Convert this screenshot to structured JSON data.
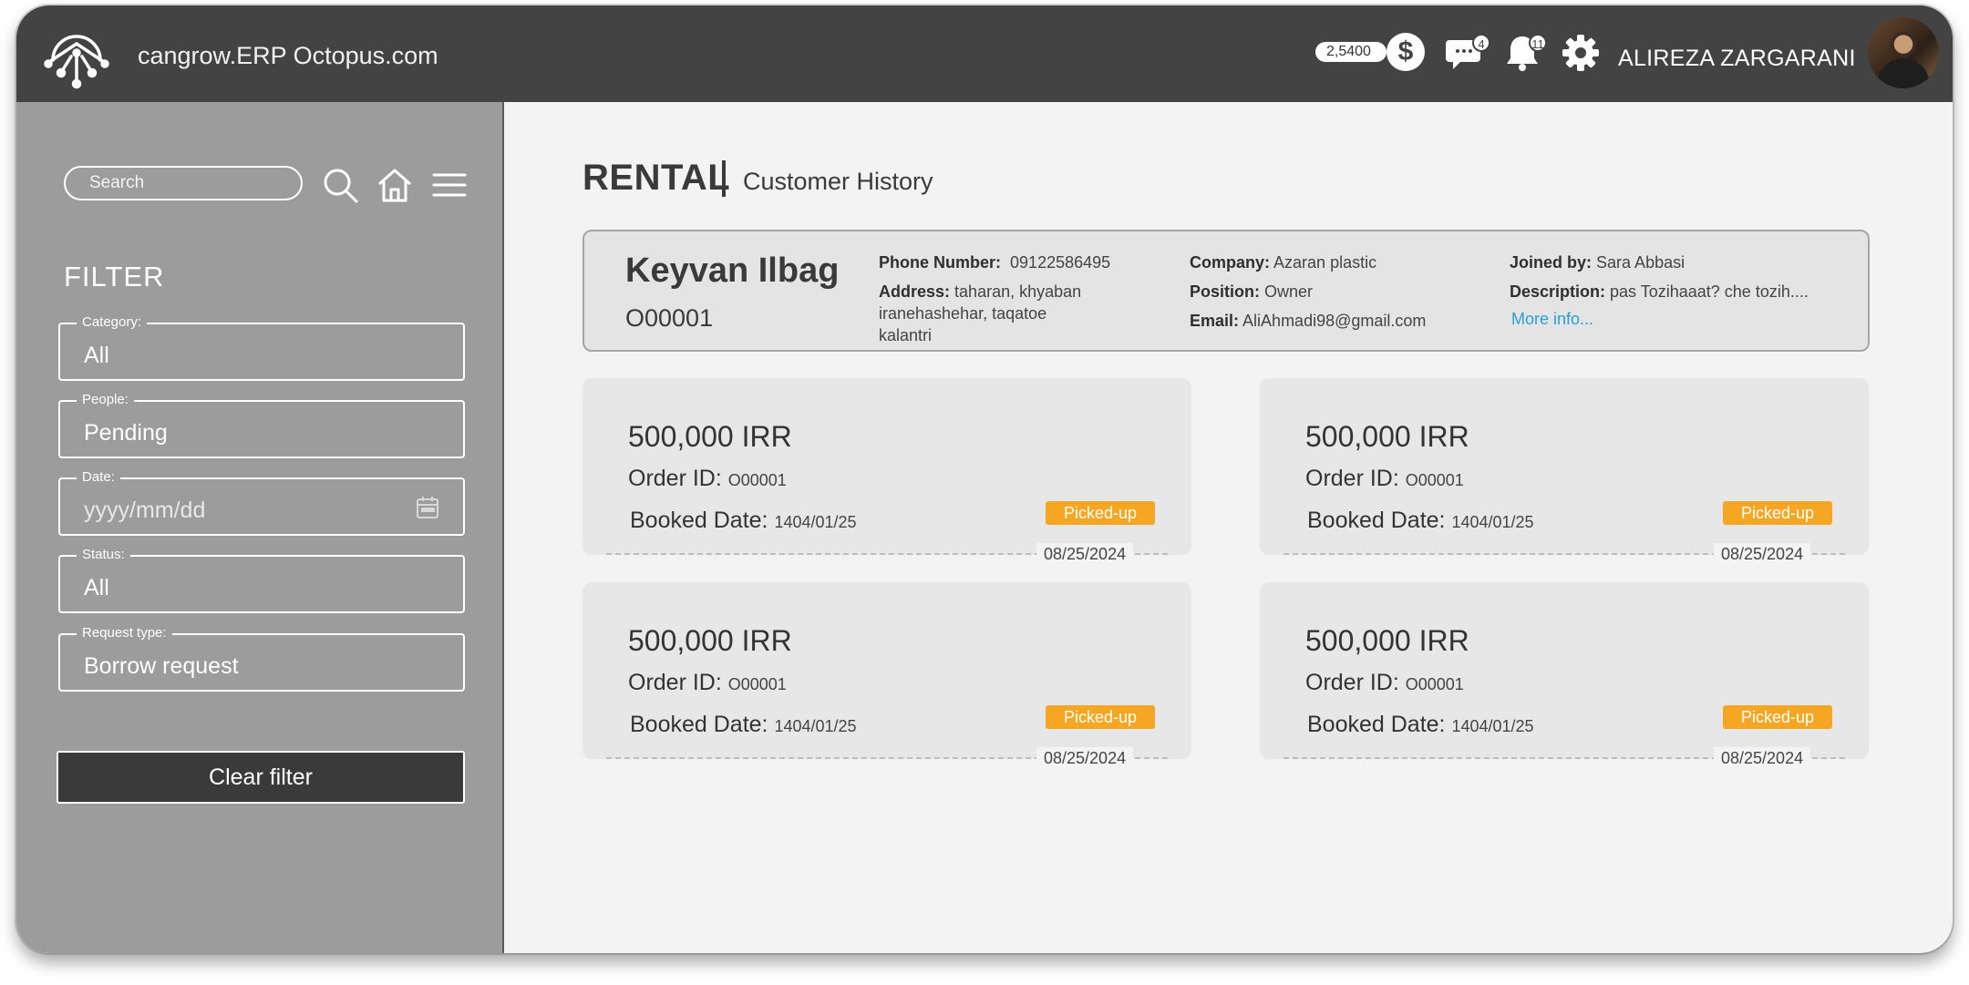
{
  "header": {
    "brand": "cangrow.ERP Octopus.com",
    "coin_balance": "2,5400",
    "coin_symbol": "$",
    "messages_count": "4",
    "notifications_count": "11",
    "user_name": "ALIREZA ZARGARANI",
    "icons": [
      "octopus-logo-icon",
      "dollar-coin-icon",
      "chat-bubble-icon",
      "bell-icon",
      "gear-icon"
    ]
  },
  "sidebar": {
    "search_placeholder": "Search",
    "filter_title": "FILTER",
    "fields": [
      {
        "label": "Category:",
        "value": "All"
      },
      {
        "label": "People:",
        "value": "Pending"
      },
      {
        "label": "Date:",
        "value": "yyyy/mm/dd"
      },
      {
        "label": "Status:",
        "value": "All"
      },
      {
        "label": "Request type:",
        "value": "Borrow request"
      }
    ],
    "clear_label": "Clear filter"
  },
  "page": {
    "title": "RENTAL",
    "subtitle": "Customer History"
  },
  "customer": {
    "name": "Keyvan Ilbag",
    "id": "O00001",
    "phone_label": "Phone Number:",
    "phone": "09122586495",
    "address_label": "Address:",
    "address": "taharan, khyaban iranehashehar, taqatoe kalantri",
    "company_label": "Company:",
    "company": "Azaran plastic",
    "position_label": "Position:",
    "position": "Owner",
    "email_label": "Email:",
    "email": "AliAhmadi98@gmail.com",
    "joined_label": "Joined by:",
    "joined": "Sara Abbasi",
    "description_label": "Description:",
    "description": "pas Tozihaaat? che tozih....",
    "more_link": "More info..."
  },
  "orders": [
    {
      "amount": "500,000 IRR",
      "order_label": "Order ID:",
      "order_id": "O00001",
      "booked_label": "Booked Date:",
      "booked_date": "1404/01/25",
      "status": "Picked-up",
      "date": "08/25/2024"
    },
    {
      "amount": "500,000 IRR",
      "order_label": "Order ID:",
      "order_id": "O00001",
      "booked_label": "Booked Date:",
      "booked_date": "1404/01/25",
      "status": "Picked-up",
      "date": "08/25/2024"
    },
    {
      "amount": "500,000 IRR",
      "order_label": "Order ID:",
      "order_id": "O00001",
      "booked_label": "Booked Date:",
      "booked_date": "1404/01/25",
      "status": "Picked-up",
      "date": "08/25/2024"
    },
    {
      "amount": "500,000 IRR",
      "order_label": "Order ID:",
      "order_id": "O00001",
      "booked_label": "Booked Date:",
      "booked_date": "1404/01/25",
      "status": "Picked-up",
      "date": "08/25/2024"
    }
  ],
  "colors": {
    "header_bg": "#434343",
    "sidebar_bg": "#9c9c9c",
    "status_orange": "#f5a623",
    "link_blue": "#2a9fd6",
    "button_dark": "#3a3a3a"
  }
}
